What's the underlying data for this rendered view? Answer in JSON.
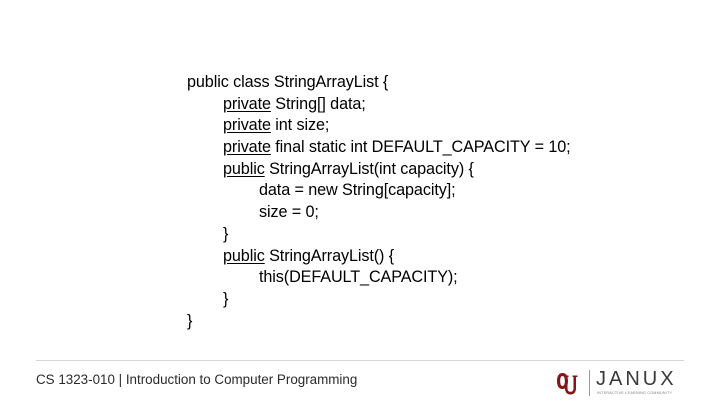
{
  "code": {
    "l1": "public class StringArrayList {",
    "l2_kw": "private",
    "l2_rest": " String[] data;",
    "l3_kw": "private",
    "l3_rest": " int size;",
    "l4_kw": "private",
    "l4_rest": " final static int DEFAULT_CAPACITY = 10;",
    "l5_kw": "public",
    "l5_rest": " StringArrayList(int capacity) {",
    "l6": "data = new String[capacity];",
    "l7": "size = 0;",
    "l8": "}",
    "l9_kw": "public",
    "l9_rest": " StringArrayList() {",
    "l10": "this(DEFAULT_CAPACITY);",
    "l11": "}",
    "l12": "}"
  },
  "footer": {
    "course": "CS 1323-010 | Introduction to Computer Programming",
    "janux_logo": "JANUX",
    "janux_tagline": "INTERACTIVE LEARNING COMMUNITY"
  },
  "colors": {
    "ou_crimson": "#841617",
    "divider": "#d6d6d6"
  }
}
